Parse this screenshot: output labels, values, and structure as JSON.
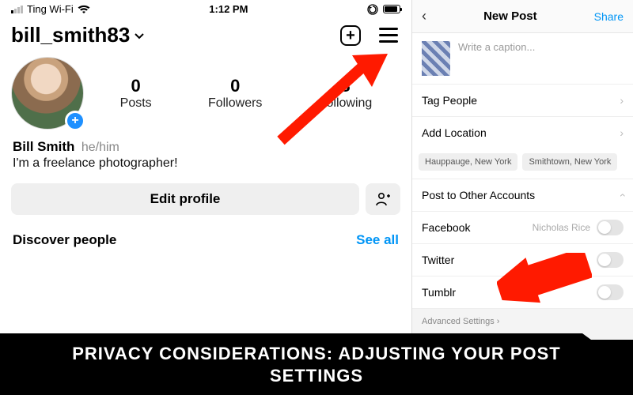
{
  "status": {
    "carrier": "Ting Wi-Fi",
    "time": "1:12 PM"
  },
  "profile": {
    "username": "bill_smith83",
    "posts_count": "0",
    "posts_label": "Posts",
    "followers_count": "0",
    "followers_label": "Followers",
    "following_count": "8",
    "following_label": "Following",
    "display_name": "Bill Smith",
    "pronouns": "he/him",
    "bio": "I'm a freelance photographer!",
    "edit_label": "Edit profile",
    "discover_label": "Discover people",
    "see_all": "See all"
  },
  "newpost": {
    "title": "New Post",
    "share": "Share",
    "caption_placeholder": "Write a caption...",
    "tag_people": "Tag People",
    "add_location": "Add Location",
    "locations": [
      "Hauppauge, New York",
      "Smithtown, New York"
    ],
    "post_other": "Post to Other Accounts",
    "facebook": "Facebook",
    "facebook_name": "Nicholas Rice",
    "twitter": "Twitter",
    "tumblr": "Tumblr",
    "advanced": "Advanced Settings"
  },
  "banner": "PRIVACY CONSIDERATIONS: ADJUSTING YOUR POST SETTINGS"
}
